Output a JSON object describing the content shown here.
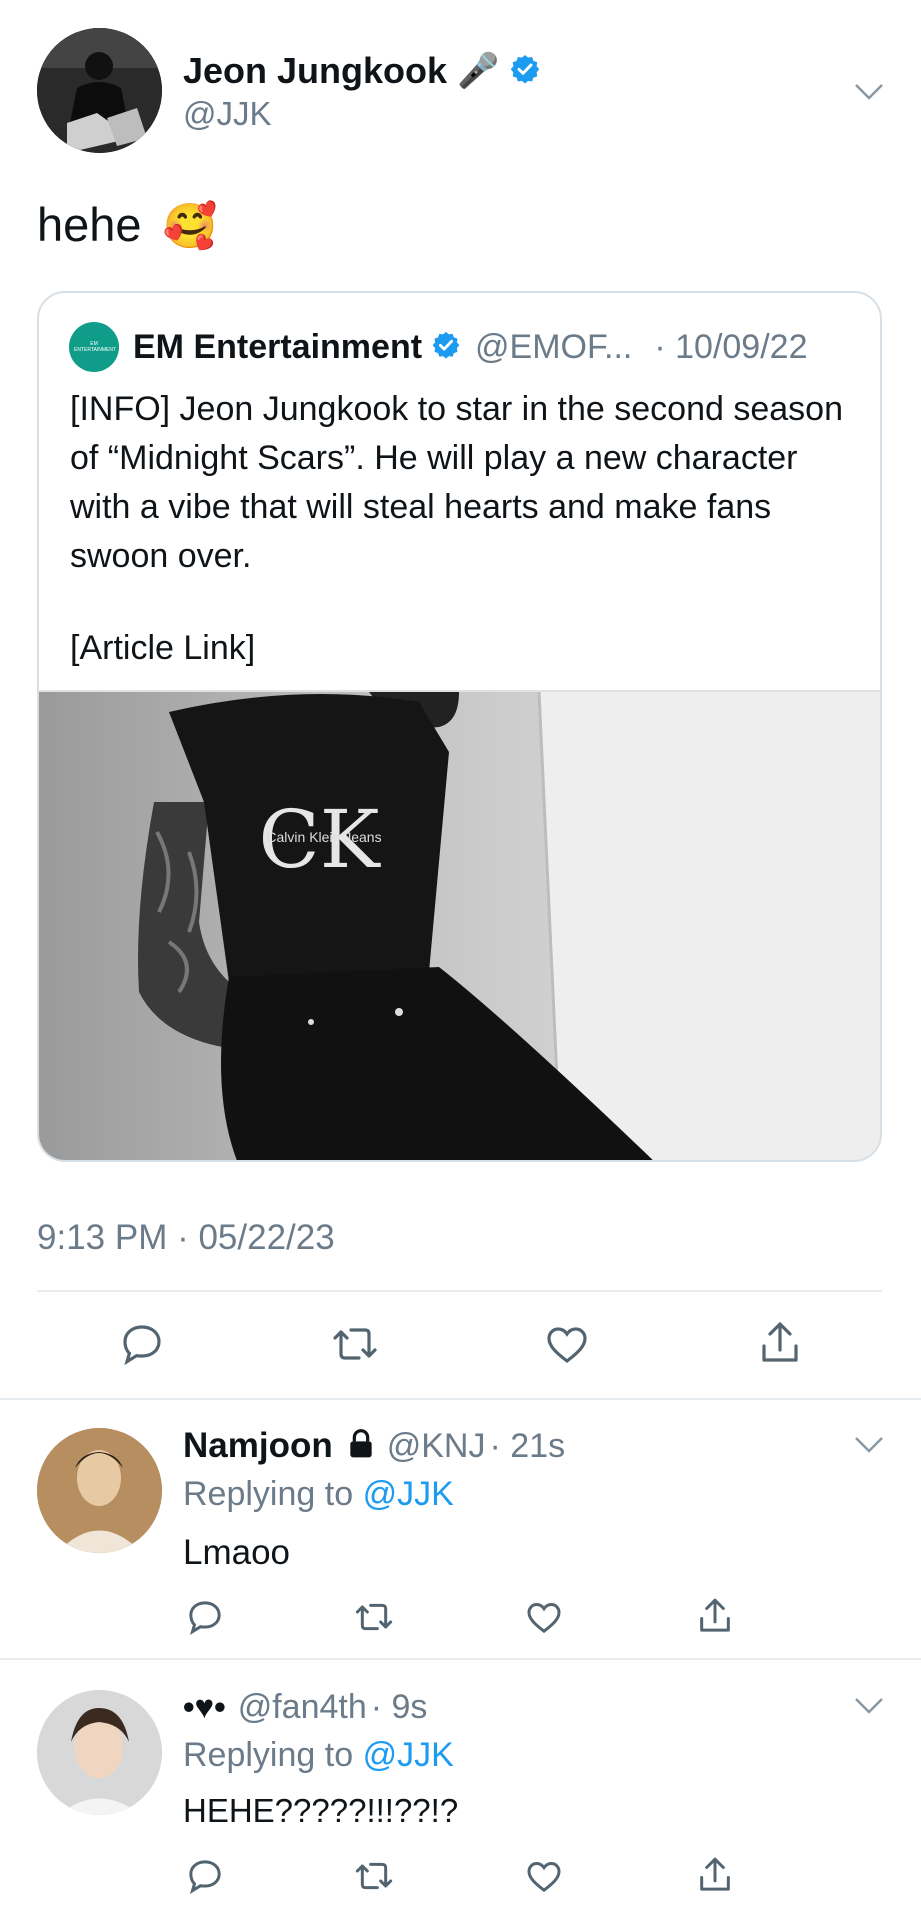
{
  "main_tweet": {
    "display_name": "Jeon Jungkook",
    "name_emoji": "🎤",
    "handle": "@JJK",
    "text": "hehe",
    "text_emoji": "🥰",
    "timestamp": "9:13 PM · 05/22/23"
  },
  "quoted_tweet": {
    "avatar_text": "EM ENTERTAINMENT",
    "display_name": "EM Entertainment",
    "handle": "@EMOF...",
    "date": "· 10/09/22",
    "body": "[INFO] Jeon Jungkook to star in the second season of “Midnight Scars”. He will play a new character with a vibe that will steal hearts and make fans swoon over.",
    "link": "[Article Link]",
    "photo_shirt_logo": "CK",
    "photo_shirt_text": "Calvin Klein Jeans"
  },
  "replies": [
    {
      "display_name": "Namjoon",
      "lock_icon": "lock-icon",
      "handle": "@KNJ",
      "time": "· 21s",
      "replying_prefix": "Replying to",
      "replying_handle": "@JJK",
      "text": "Lmaoo"
    },
    {
      "display_name": "•♥•",
      "handle": "@fan4th",
      "time": "· 9s",
      "replying_prefix": "Replying to",
      "replying_handle": "@JJK",
      "text": "HEHE?????!!!??!?"
    }
  ],
  "colors": {
    "accent": "#1d9bf0",
    "muted": "#6b7b8a",
    "brand_green": "#0f9d8a"
  }
}
